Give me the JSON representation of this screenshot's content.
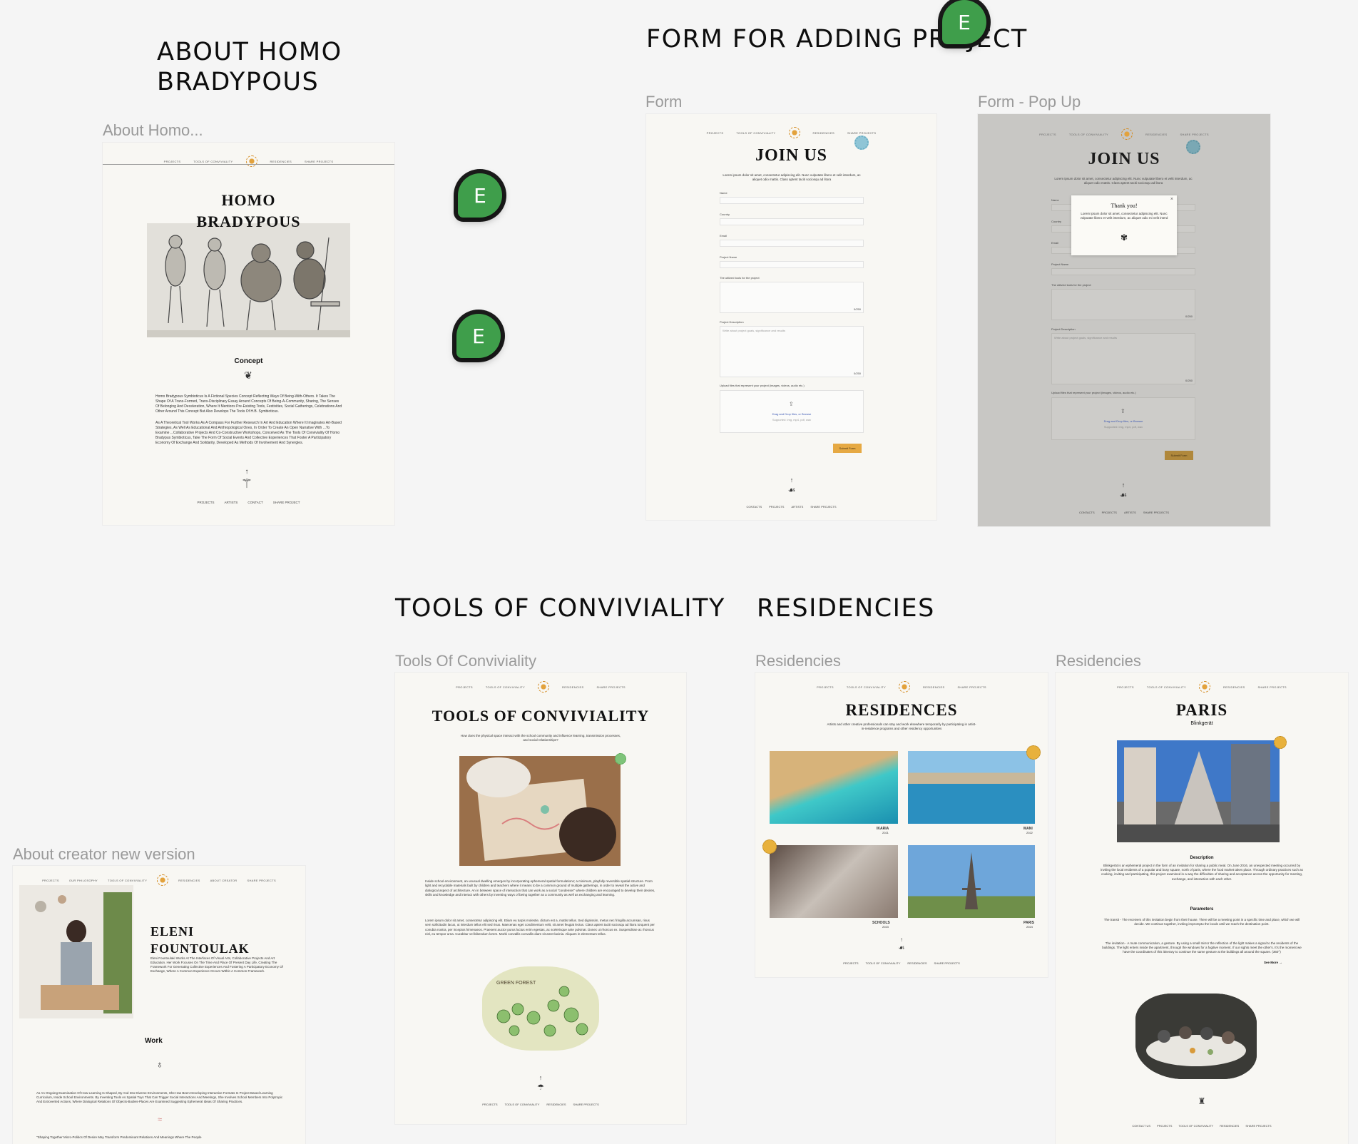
{
  "sections": {
    "about": "ABOUT HOMO\nBRADYPOUS",
    "form": "FORM FOR ADDING PROJECT",
    "tools": "TOOLS OF CONVIVIALITY",
    "residencies": "RESIDENCIES"
  },
  "frame_labels": {
    "about": "About Homo...",
    "form": "Form",
    "form_popup": "Form - Pop Up",
    "tools": "Tools Of Conviviality",
    "residencies1": "Residencies",
    "residencies2": "Residencies",
    "creator": "About creator new version"
  },
  "nav": {
    "projects": "PROJECTS",
    "tools": "TOOLS OF CONVIVIALITY",
    "residencies": "RESIDENCIES",
    "share": "SHARE PROJECTS",
    "philosophy": "OUR PHILOSOPHY",
    "about_creator": "ABOUT CREATOR"
  },
  "about_page": {
    "title": "HOMO\nBRADYPOUS",
    "concept": "Concept",
    "para1": "Homo Bradypous Symbioticus Is A Fictional Species Concept Reflecting Ways Of Being-With-Others. It Takes The Shape Of A Trans-Formed, Trans-Disciplinary Essay Around Concepts Of Being-A-Community, Sharing, The Senses Of Belonging And Deceleration, Where It Mentions Pre-Existing Tools, Festivities, Social Gatherings, Celebrations And Other Around This Concept But Also Develops The Tools Of H.B. Symbioticus.",
    "para2": "As A Theoretical Tool Works As A Compass For Further Research In Art And Education Where It Imaginates Art-Based Strategies, As Well As Educational And Anthropological Ones, In Order To Create An Open Narrative With ...To Examine ...Collaborative Projects And Co-Constructive Workshops, Conceived As The Tools Of Conviviality Of Homo Bradypus Symbioticus, Take The Form Of Social Events And Collective Experiences That Foster A Participatory Economy Of Exchange And Solidarity, Developed As Methods Of Involvement And Synergies.",
    "footer": [
      "PROJECTS",
      "ARTISTS",
      "CONTACT",
      "SHARE PROJECT"
    ]
  },
  "form_page": {
    "title": "JOIN US",
    "intro": "Lorem ipsum dolor sit amet, consectetur adipiscing elit. Nunc vulputate libero et velit interdum, ac aliquet odio mattis. Class aptent taciti sociosqu ad litora",
    "badge": "",
    "name": "Name",
    "country": "Country",
    "email": "Email",
    "project_name": "Project Name",
    "tools": "The utilized tools for the project",
    "counter": "0/250",
    "description": "Project Description",
    "desc_placeholder": "Write about project goals, significance and results",
    "upload": "Upload files that represent your project (images, videos, audio etc.)",
    "drag": "Drag and Drop files, or Browse",
    "supported": "Supported: img, mp4, pdf, wav",
    "submit": "Submit Form",
    "footer": [
      "CONTACTS",
      "PROJECTS",
      "ARTISTS",
      "SHARE PROJECTS"
    ]
  },
  "popup": {
    "title": "Thank you!",
    "text": "Lorem ipsum dolor sit amet, consectetur adipiscing elit. Nunc vulputate libero et velit interdum, ac aliquet odio mi velit interd"
  },
  "tools_page": {
    "title": "TOOLS OF CONVIVIALITY",
    "subtitle": "How does the physical space interact with the school community and influence learning, transmission processes, and social relationships?",
    "para1": "Inside school environment, an unusual dwelling emerges by incorporating ephemeral spatial formulations; a minimum, playfully reversible spatial structure. From light and recyclable materials built by children and teachers where it means to be a common ground of multiple gatherings, in order to reveal the active and dialogical aspect of architecture. An in between space of interaction that can work as a social \"condenser\" where children are encouraged to develop their desires, skills and knowledge and interact with others by inventing ways of being together as a community as well as exchanging and learning.",
    "para2": "Lorem ipsum dolor sit amet, consectetur adipiscing elit. Etiam eu turpis molestie, dictum est a, mattis tellus. Sed dignissim, metus nec fringilla accumsan, risus sem sollicitudin lacus, ut interdum tellus elit sed risus. Maecenas eget condimentum velit, sit amet feugiat lectus. Class aptent taciti sociosqu ad litora torquent per conubia nostra, per inceptos himenaeos. Praesent auctor purus luctus enim egestas, ac scelerisque ante pulvinar. Donec ut rhoncus ex. Suspendisse ac rhoncus nisl, eu tempor urna. Curabitur vel bibendum lorem. Morbi convallis convallis diam sit amet lacinia. Aliquam in elementum tellus.",
    "map_label": "GREEN FOREST",
    "footer": [
      "PROJECTS",
      "TOOLS OF CONVIVIALITY",
      "RESIDENCIES",
      "SHARE PROJECTS"
    ]
  },
  "residences_page": {
    "title": "RESIDENCES",
    "subtitle": "Artists and other creative professionals can stay and work elsewhere temporarily by participating in artist-in-residence programs and other residency opportunities",
    "places": [
      {
        "name": "IKARIA",
        "year": "2021"
      },
      {
        "name": "MANI",
        "year": "2022"
      },
      {
        "name": "SCHOOLS",
        "year": "2023"
      },
      {
        "name": "PARIS",
        "year": "2024"
      }
    ],
    "footer": [
      "PROJECTS",
      "TOOLS OF CONVIVIALITY",
      "RESIDENCIES",
      "SHARE PROJECTS"
    ]
  },
  "paris_page": {
    "title": "PARIS",
    "subtitle": "Blinkgerät",
    "description_h": "Description",
    "description": "Blinkgerät is an ephemeral project in the form of an invitation for sharing a public meal. On June 2016, an unexpected meeting occurred by inviting the local residents of a popular and busy square, north of paris, where the food market takes place. Through ordinary practices such as cooking, inviting and participating, this project examined in a way the difficulties of sharing and acceptance across the opportunity for meeting, exchange, and interaction with each other.",
    "parameters_h": "Parameters",
    "param1": "The transit - The receivers of this invitation begin from their house. There will be a meeting point in a specific time and place, which we will decide. We continue together, inviting impromptu the locals until we reach the destination point.",
    "param2": "The invitation - A mute communication, a gesture. By using a small mirror the reflection of the light makes a signal to the residents of the buildings. The light enters inside the apartment, through the windows for a fugitive moment. If our sights meet the other's. It's the moment we have the coordinates of this itinerary to continue the same gesture at the buildings all around the square. (360°)",
    "see_more": "See More →",
    "footer": [
      "CONTACT US",
      "PROJECTS",
      "TOOLS OF CONVIVIALITY",
      "RESIDENCIES",
      "SHARE PROJECTS"
    ]
  },
  "creator_page": {
    "name": "ELENI\nFOUNTOULAK",
    "bio": "Eleni Fountoulaki Works At The Interfaces Of Visual Arts, Collaborative Projects And Art Education. Her Work Focuses On The Time And Place Of Present Day Life, Creating The Framework For Generating Collective Experiences And Fostering A Participatory Economy Of Exchange, Where A Common Experience Occurs Within A Common Framework.",
    "work": "Work",
    "work_text": "As An Ongoing Examination Of How Learning Is Shaped, By And Into Diverse Environments, She Has Been Developing Interactive Formats In Project-Based Learning Curriculum, Inside School Environments. By Inventing Tools As Spatial Toys That Can Trigger Social Interactions And Meetings, She Involves School Members Into Polytropic And Extroverted Actions, Where Dialogical Relations Of Objects-Bodies-Places Are Examined Suggesting Ephemeral Ideas Of Sharing Practices.",
    "quote": "\"Shaping Together Micro-Politics Of Desire May Transform Predominant Relations And Meanings Where The People"
  },
  "avatars": [
    "E",
    "E",
    "E"
  ]
}
